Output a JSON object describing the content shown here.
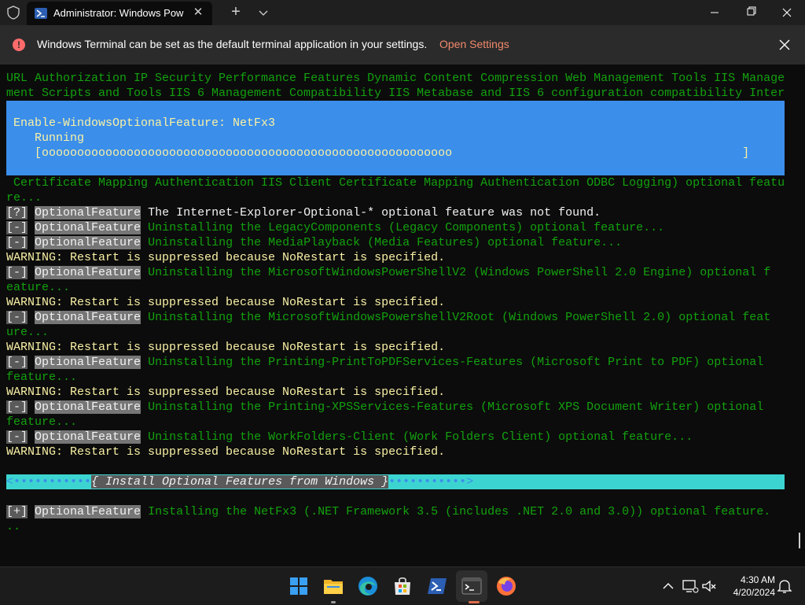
{
  "window": {
    "tab_title": "Administrator: Windows PowerShell",
    "new_tab_label": "+",
    "tab_close_label": "✕"
  },
  "notification": {
    "icon": "!",
    "message": "Windows Terminal can be set as the default terminal application in your settings.",
    "link": "Open Settings"
  },
  "terminal": {
    "line1": "URL Authorization IP Security Performance Features Dynamic Content Compression Web Management Tools IIS Manage",
    "line2": "ment Scripts and Tools IIS 6 Management Compatibility IIS Metabase and IIS 6 configuration compatibility Inter",
    "progress": {
      "title": "Enable-WindowsOptionalFeature: NetFx3",
      "status": "Running",
      "bar": "[oooooooooooooooooooooooooooooooooooooooooooooooooooooooooo                                         ]"
    },
    "line3": " Certificate Mapping Authentication IIS Client Certificate Mapping Authentication ODBC Logging) optional featu",
    "line4": "re...",
    "tag": "OptionalFeature",
    "entries": [
      {
        "marker": "[?]",
        "text": "The Internet-Explorer-Optional-* optional feature was not found."
      },
      {
        "marker": "[-]",
        "text": "Uninstalling the LegacyComponents (Legacy Components) optional feature..."
      },
      {
        "marker": "[-]",
        "text": "Uninstalling the MediaPlayback (Media Features) optional feature..."
      },
      {
        "warning": "WARNING: Restart is suppressed because NoRestart is specified."
      },
      {
        "marker": "[-]",
        "text": "Uninstalling the MicrosoftWindowsPowerShellV2 (Windows PowerShell 2.0 Engine) optional f"
      },
      {
        "cont": "eature..."
      },
      {
        "warning": "WARNING: Restart is suppressed because NoRestart is specified."
      },
      {
        "marker": "[-]",
        "text": "Uninstalling the MicrosoftWindowsPowershellV2Root (Windows PowerShell 2.0) optional feat"
      },
      {
        "cont": "ure..."
      },
      {
        "warning": "WARNING: Restart is suppressed because NoRestart is specified."
      },
      {
        "marker": "[-]",
        "text": "Uninstalling the Printing-PrintToPDFServices-Features (Microsoft Print to PDF) optional"
      },
      {
        "cont": "feature..."
      },
      {
        "warning": "WARNING: Restart is suppressed because NoRestart is specified."
      },
      {
        "marker": "[-]",
        "text": "Uninstalling the Printing-XPSServices-Features (Microsoft XPS Document Writer) optional"
      },
      {
        "cont": "feature..."
      },
      {
        "marker": "[-]",
        "text": "Uninstalling the WorkFolders-Client (Work Folders Client) optional feature..."
      },
      {
        "warning": "WARNING: Restart is suppressed because NoRestart is specified."
      }
    ],
    "banner": {
      "left": "<•••••••••••",
      "middle": "{ Install Optional Features from Windows }",
      "right": "•••••••••••>"
    },
    "install": {
      "marker": "[+]",
      "text": "Installing the NetFx3 (.NET Framework 3.5 (includes .NET 2.0 and 3.0)) optional feature.",
      "cont": ".."
    }
  },
  "taskbar": {
    "icons": [
      "windows-start-icon",
      "file-explorer-icon",
      "edge-icon",
      "store-icon",
      "powershell-icon",
      "terminal-icon",
      "firefox-icon"
    ],
    "time": "4:30 AM",
    "date": "4/20/2024"
  },
  "colors": {
    "terminal_green": "#13a10e",
    "warning_yellow": "#f9f1a5",
    "progress_blue": "#3b8eea",
    "banner_cyan": "#3cd4d0"
  }
}
